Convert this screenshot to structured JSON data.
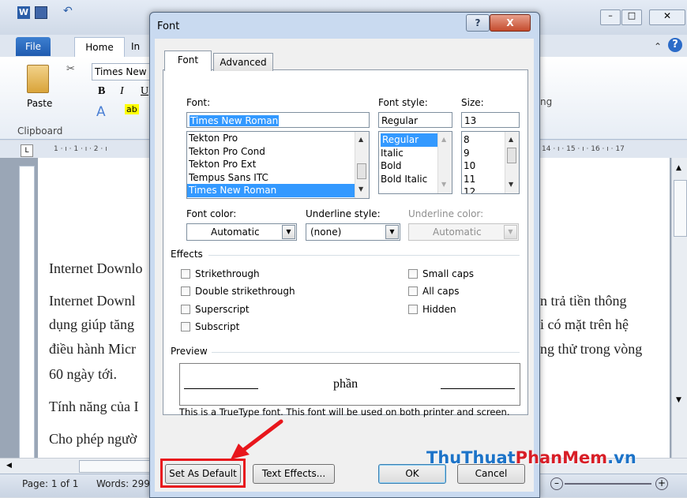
{
  "word": {
    "tabs": [
      "File",
      "Home",
      "In"
    ],
    "font_box": "Times New",
    "paste_label": "Paste",
    "clipboard_label": "Clipboard",
    "ruler_right": "14 · ı · 15 · ı · 16 · ı · 17",
    "ruler_left": "1 · ı · 1 · ı · 2 · ı",
    "ribbon_right": "ng",
    "doc_lines_left": [
      "Internet Downlo",
      "Internet Downl",
      "dụng giúp tăng",
      "điều hành Micr",
      "60 ngày tới.",
      "Tính năng của I",
      "Cho phép ngườ"
    ],
    "doc_lines_right": [
      "n trả tiền thông",
      "i có mặt trên hệ",
      "ng thử trong vòng"
    ],
    "status_page": "Page: 1 of 1",
    "status_words": "Words: 299"
  },
  "dialog": {
    "title": "Font",
    "help": "?",
    "close": "X",
    "tabs": {
      "font": "Font",
      "advanced": "Advanced"
    },
    "font_label": "Font:",
    "font_value": "Times New Roman",
    "font_list": [
      "Tekton Pro",
      "Tekton Pro Cond",
      "Tekton Pro Ext",
      "Tempus Sans ITC",
      "Times New Roman"
    ],
    "style_label": "Font style:",
    "style_value": "Regular",
    "style_list": [
      "Regular",
      "Italic",
      "Bold",
      "Bold Italic"
    ],
    "size_label": "Size:",
    "size_value": "13",
    "size_list": [
      "8",
      "9",
      "10",
      "11",
      "12"
    ],
    "font_color_label": "Font color:",
    "font_color_value": "Automatic",
    "underline_style_label": "Underline style:",
    "underline_style_value": "(none)",
    "underline_color_label": "Underline color:",
    "underline_color_value": "Automatic",
    "effects_label": "Effects",
    "effects_left": [
      "Strikethrough",
      "Double strikethrough",
      "Superscript",
      "Subscript"
    ],
    "effects_right": [
      "Small caps",
      "All caps",
      "Hidden"
    ],
    "preview_label": "Preview",
    "preview_text": "phần",
    "preview_note": "This is a TrueType font. This font will be used on both printer and screen.",
    "buttons": {
      "set_default": "Set As Default",
      "text_effects": "Text Effects...",
      "ok": "OK",
      "cancel": "Cancel"
    }
  },
  "watermark": {
    "part1": "ThuThuat",
    "part2": "PhanMem",
    "part3": ".vn"
  },
  "colors": {
    "accent_red": "#e8161c",
    "selection": "#3399ff",
    "watermark_blue": "#1c73c8",
    "watermark_red": "#d81e27"
  }
}
